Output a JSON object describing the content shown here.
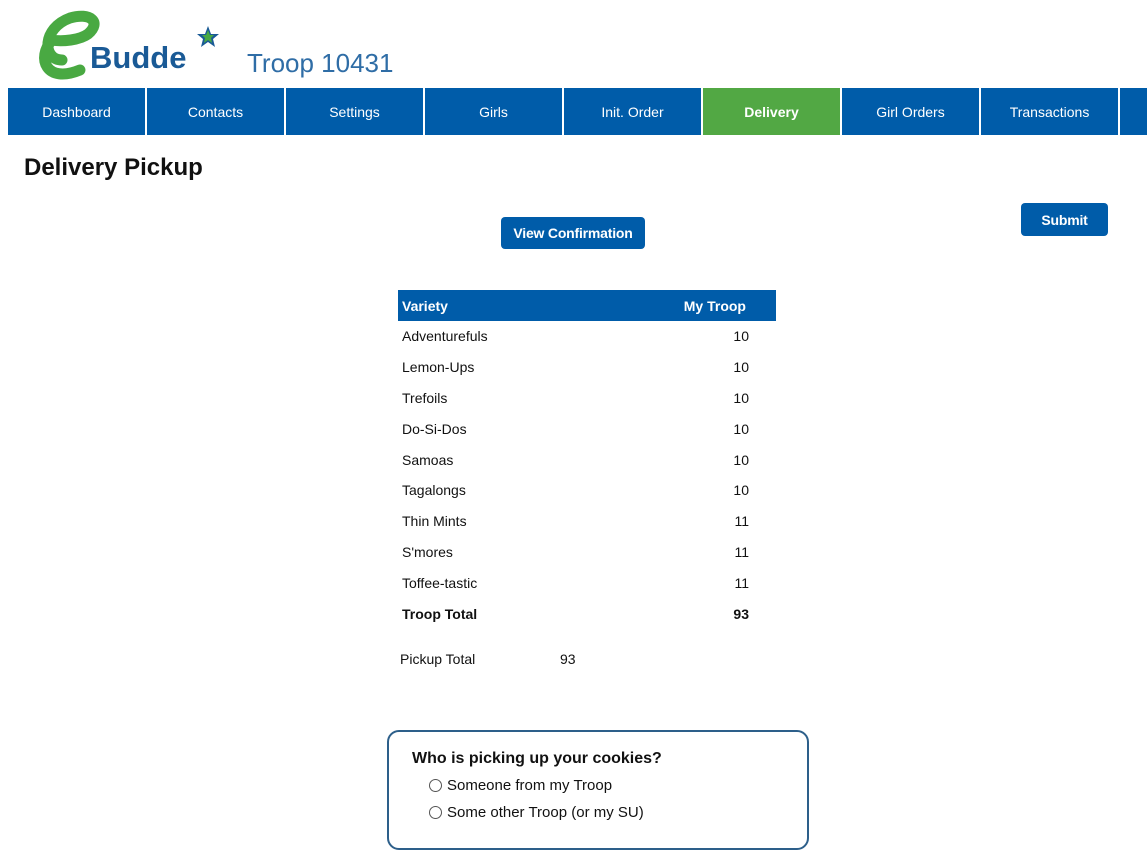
{
  "header": {
    "logo_text": "eBudde",
    "troop_title": "Troop 10431"
  },
  "nav": {
    "items": [
      {
        "label": "Dashboard"
      },
      {
        "label": "Contacts"
      },
      {
        "label": "Settings"
      },
      {
        "label": "Girls"
      },
      {
        "label": "Init. Order"
      },
      {
        "label": "Delivery",
        "active": true
      },
      {
        "label": "Girl Orders"
      },
      {
        "label": "Transactions"
      }
    ]
  },
  "page": {
    "title": "Delivery Pickup",
    "view_confirmation_label": "View Confirmation",
    "submit_label": "Submit"
  },
  "table": {
    "headers": [
      "Variety",
      "My Troop"
    ],
    "rows": [
      {
        "variety": "Adventurefuls",
        "qty": "10"
      },
      {
        "variety": "Lemon-Ups",
        "qty": "10"
      },
      {
        "variety": "Trefoils",
        "qty": "10"
      },
      {
        "variety": "Do-Si-Dos",
        "qty": "10"
      },
      {
        "variety": "Samoas",
        "qty": "10"
      },
      {
        "variety": "Tagalongs",
        "qty": "10"
      },
      {
        "variety": "Thin Mints",
        "qty": "11"
      },
      {
        "variety": "S'mores",
        "qty": "11"
      },
      {
        "variety": "Toffee-tastic",
        "qty": "11"
      }
    ],
    "total": {
      "label": "Troop Total",
      "qty": "93"
    }
  },
  "pickup": {
    "label": "Pickup Total",
    "value": "93"
  },
  "pickup_question": {
    "question": "Who is picking up your cookies?",
    "options": [
      "Someone from my Troop",
      "Some other Troop (or my SU)"
    ]
  },
  "colors": {
    "nav_blue": "#005ca9",
    "active_green": "#52a844",
    "logo_green": "#49a942",
    "logo_blue": "#1a5a96"
  }
}
